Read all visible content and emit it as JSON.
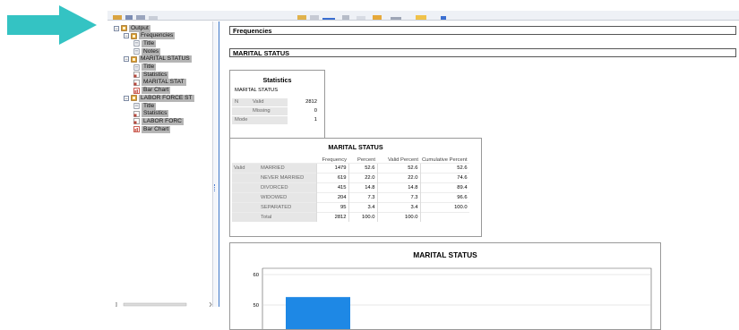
{
  "colors": {
    "accent": "#34c3c3",
    "bar_blue": "#1e88e5",
    "tree_highlight": "#b5b5b5"
  },
  "tree": {
    "items": [
      {
        "label": "Output",
        "icon": "output-book-icon",
        "level": 0
      },
      {
        "label": "Frequencies",
        "icon": "frequencies-book-icon",
        "level": 1
      },
      {
        "label": "Title",
        "icon": "title-doc-icon",
        "level": 2
      },
      {
        "label": "Notes",
        "icon": "notes-doc-icon",
        "level": 2
      },
      {
        "label": "MARITAL STATUS",
        "icon": "marital-book-icon",
        "level": 1
      },
      {
        "label": "Title",
        "icon": "title-doc-icon",
        "level": 2
      },
      {
        "label": "Statistics",
        "icon": "statistics-table-icon",
        "level": 2
      },
      {
        "label": "MARITAL STAT",
        "icon": "marital-table-icon",
        "level": 2
      },
      {
        "label": "Bar Chart",
        "icon": "bar-chart-icon",
        "level": 2
      },
      {
        "label": "LABOR FORCE ST",
        "icon": "labor-book-icon",
        "level": 1
      },
      {
        "label": "Title",
        "icon": "title-doc-icon",
        "level": 2
      },
      {
        "label": "Statistics",
        "icon": "statistics-table-icon",
        "level": 2
      },
      {
        "label": "LABOR FORC",
        "icon": "labor-table-icon",
        "level": 2
      },
      {
        "label": "Bar Chart",
        "icon": "bar-chart-icon",
        "level": 2
      }
    ]
  },
  "output": {
    "frequencies_heading": "Frequencies",
    "marital_heading": "MARITAL STATUS"
  },
  "statistics": {
    "title": "Statistics",
    "subtitle": "MARITAL STATUS",
    "n_label": "N",
    "valid_label": "Valid",
    "valid_value": "2812",
    "missing_label": "Missing",
    "missing_value": "0",
    "mode_label": "Mode",
    "mode_value": "1"
  },
  "frequency_table": {
    "title": "MARITAL STATUS",
    "headers": [
      "Frequency",
      "Percent",
      "Valid Percent",
      "Cumulative Percent"
    ],
    "group_label": "Valid",
    "rows": [
      {
        "label": "MARRIED",
        "frequency": "1479",
        "percent": "52.6",
        "valid_percent": "52.6",
        "cumulative": "52.6"
      },
      {
        "label": "NEVER MARRIED",
        "frequency": "619",
        "percent": "22.0",
        "valid_percent": "22.0",
        "cumulative": "74.6"
      },
      {
        "label": "DIVORCED",
        "frequency": "415",
        "percent": "14.8",
        "valid_percent": "14.8",
        "cumulative": "89.4"
      },
      {
        "label": "WIDOWED",
        "frequency": "204",
        "percent": "7.3",
        "valid_percent": "7.3",
        "cumulative": "96.6"
      },
      {
        "label": "SEPARATED",
        "frequency": "95",
        "percent": "3.4",
        "valid_percent": "3.4",
        "cumulative": "100.0"
      },
      {
        "label": "Total",
        "frequency": "2812",
        "percent": "100.0",
        "valid_percent": "100.0",
        "cumulative": ""
      }
    ]
  },
  "chart_data": {
    "type": "bar",
    "title": "MARITAL STATUS",
    "yticks": [
      50,
      60
    ],
    "visible_bar": {
      "category": "MARRIED",
      "value": 52.6
    },
    "color": "#1e88e5"
  }
}
